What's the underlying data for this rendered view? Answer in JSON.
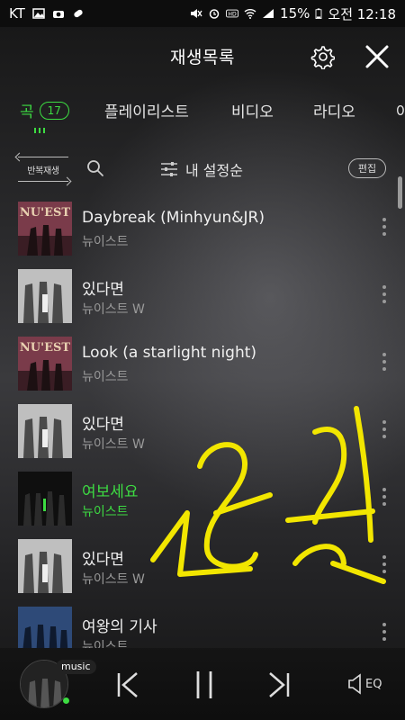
{
  "status_bar": {
    "carrier": "KT",
    "battery": "15%",
    "time": "오전 12:18"
  },
  "header": {
    "title": "재생목록"
  },
  "tabs": [
    {
      "label": "곡",
      "count": "17",
      "active": true
    },
    {
      "label": "플레이리스트"
    },
    {
      "label": "비디오"
    },
    {
      "label": "라디오"
    },
    {
      "label": "아"
    }
  ],
  "toolbar": {
    "repeat_label": "반복재생",
    "sort_label": "내 설정순",
    "edit_label": "편집"
  },
  "songs": [
    {
      "title": "Daybreak (Minhyun&JR)",
      "artist": "뉴이스트",
      "art": "nuest-red",
      "playing": false
    },
    {
      "title": "있다면",
      "artist": "뉴이스트 W",
      "art": "w-gray",
      "playing": false
    },
    {
      "title": "Look (a starlight night)",
      "artist": "뉴이스트",
      "art": "nuest-red",
      "playing": false
    },
    {
      "title": "있다면",
      "artist": "뉴이스트 W",
      "art": "w-gray",
      "playing": false
    },
    {
      "title": "여보세요",
      "artist": "뉴이스트",
      "art": "dark-green",
      "playing": true
    },
    {
      "title": "있다면",
      "artist": "뉴이스트 W",
      "art": "w-gray",
      "playing": false
    },
    {
      "title": "여왕의 기사",
      "artist": "뉴이스트",
      "art": "blue",
      "playing": false
    }
  ],
  "player": {
    "badge": "music",
    "eq_label": "EQ"
  },
  "colors": {
    "accent": "#3ddc42",
    "scribble": "#f2e600"
  }
}
